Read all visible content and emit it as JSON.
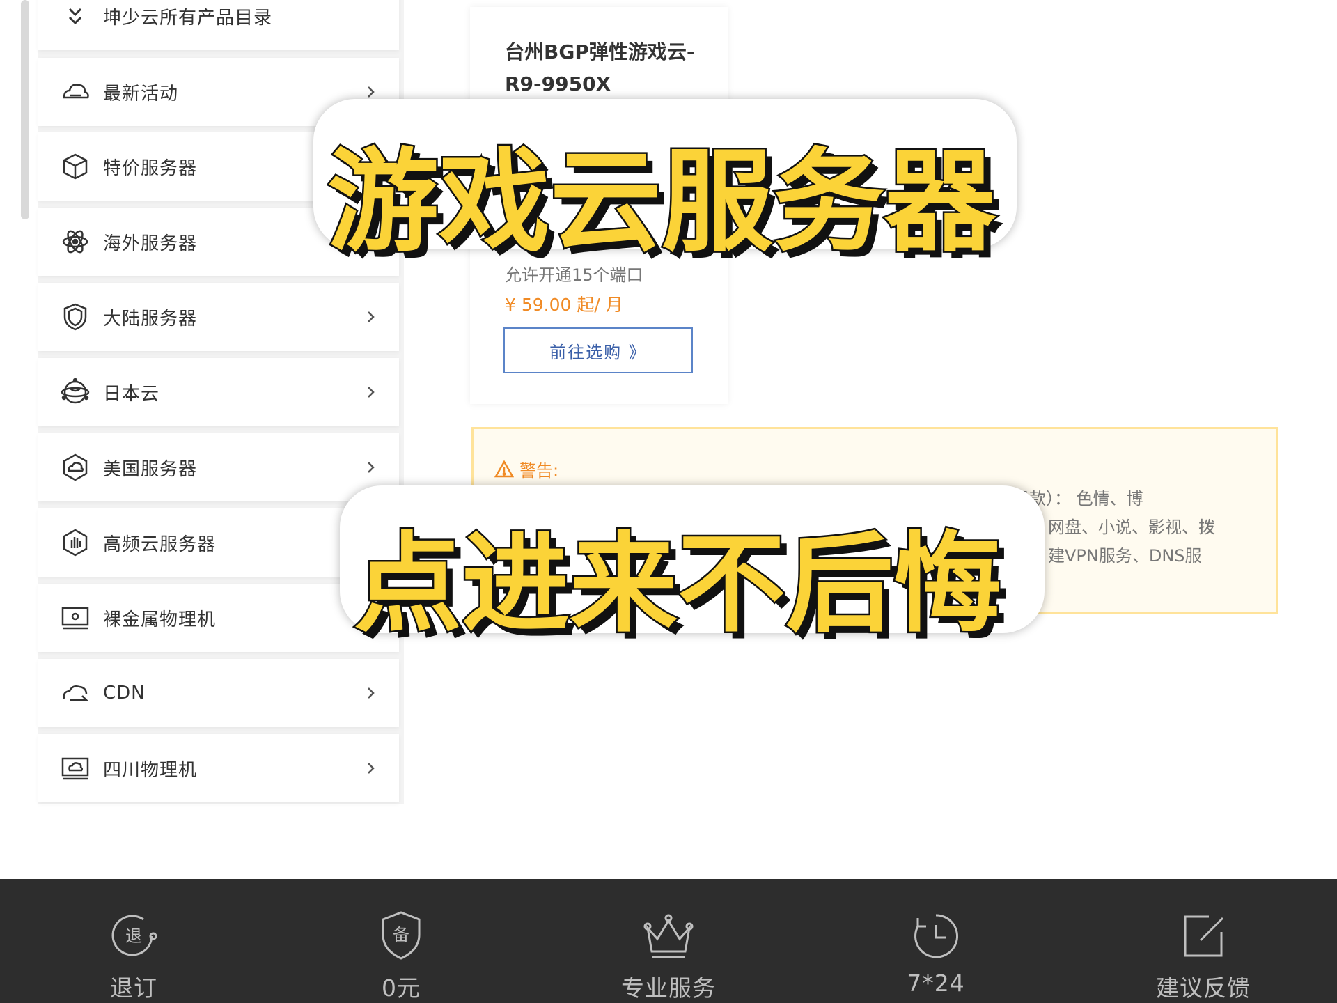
{
  "sidebar": {
    "items": [
      {
        "label": "坤少云所有产品目录",
        "icon": "double-chevron-down-icon",
        "has_arrow": false
      },
      {
        "label": "最新活动",
        "icon": "cloud-icon",
        "has_arrow": true
      },
      {
        "label": "特价服务器",
        "icon": "cube-icon",
        "has_arrow": false
      },
      {
        "label": "海外服务器",
        "icon": "atom-icon",
        "has_arrow": false
      },
      {
        "label": "大陆服务器",
        "icon": "shield-icon",
        "has_arrow": true
      },
      {
        "label": "日本云",
        "icon": "globe-icon",
        "has_arrow": true
      },
      {
        "label": "美国服务器",
        "icon": "hexagon-cloud-icon",
        "has_arrow": true
      },
      {
        "label": "高频云服务器",
        "icon": "hexagon-hand-icon",
        "has_arrow": false
      },
      {
        "label": "裸金属物理机",
        "icon": "monitor-icon",
        "has_arrow": false
      },
      {
        "label": "CDN",
        "icon": "cdn-cloud-icon",
        "has_arrow": true
      },
      {
        "label": "四川物理机",
        "icon": "monitor-cloud-icon",
        "has_arrow": true
      }
    ]
  },
  "product_card": {
    "title": "台州BGP弹性游戏云-R9-9950X",
    "spec": "允许开通15个端口",
    "price": "¥ 59.00 起/ 月",
    "buy_label": "前往选购 》"
  },
  "warning": {
    "heading": "警告:",
    "line1": "所有服务器禁止用于以下业务及服务（一经发现，立即永久关闭，概不退款）： 色情、博",
    "line2": "网盘、小说、影视、拨",
    "line3": "建VPN服务、DNS服"
  },
  "overlay": {
    "headline": "游戏云服务器",
    "subline": "点进来不后悔"
  },
  "bottom_bar": {
    "items": [
      {
        "label": "退订",
        "icon": "refund-icon"
      },
      {
        "label": "0元",
        "icon": "filing-shield-icon"
      },
      {
        "label": "专业服务",
        "icon": "crown-icon"
      },
      {
        "label": "7*24",
        "icon": "clock-icon"
      },
      {
        "label": "建议反馈",
        "icon": "feedback-edit-icon"
      }
    ]
  },
  "colors": {
    "caption_yellow": "#fbd338",
    "price_orange": "#f08a24",
    "button_blue": "#3a5fa8",
    "bottom_bar": "#2d2d2d"
  }
}
